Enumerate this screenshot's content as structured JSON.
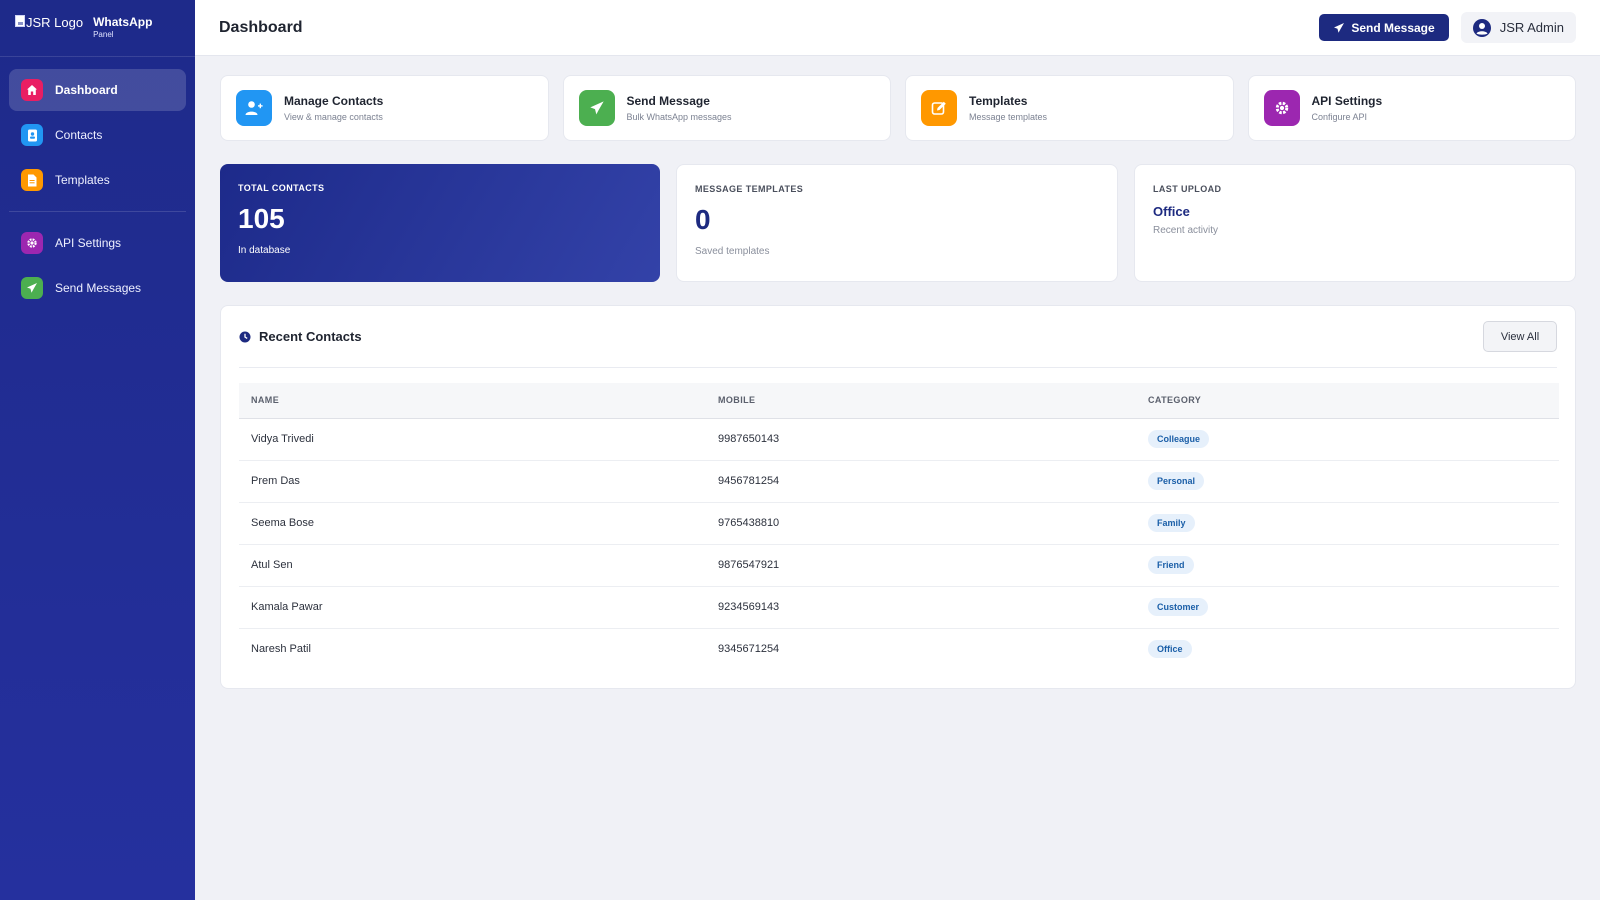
{
  "sidebar": {
    "logo_alt": "JSR Logo",
    "brand_title": "WhatsApp",
    "brand_subtitle": "Panel",
    "items": [
      {
        "label": "Dashboard",
        "icon": "home-icon",
        "color": "#e91e63"
      },
      {
        "label": "Contacts",
        "icon": "contacts-icon",
        "color": "#2196f3"
      },
      {
        "label": "Templates",
        "icon": "document-icon",
        "color": "#ff9800"
      },
      {
        "label": "API Settings",
        "icon": "gear-icon",
        "color": "#9c27b0"
      },
      {
        "label": "Send Messages",
        "icon": "paper-plane-icon",
        "color": "#4caf50"
      }
    ]
  },
  "header": {
    "title": "Dashboard",
    "send_button": "Send Message",
    "user_name": "JSR Admin"
  },
  "quick_actions": [
    {
      "title": "Manage Contacts",
      "subtitle": "View & manage contacts",
      "icon": "add-user-icon",
      "color": "#2196f3"
    },
    {
      "title": "Send Message",
      "subtitle": "Bulk WhatsApp messages",
      "icon": "paper-plane-icon",
      "color": "#4caf50"
    },
    {
      "title": "Templates",
      "subtitle": "Message templates",
      "icon": "edit-icon",
      "color": "#ff9800"
    },
    {
      "title": "API Settings",
      "subtitle": "Configure API",
      "icon": "gear-icon",
      "color": "#9c27b0"
    }
  ],
  "stats": {
    "total_contacts": {
      "label": "TOTAL CONTACTS",
      "value": "105",
      "sub": "In database"
    },
    "message_templates": {
      "label": "MESSAGE TEMPLATES",
      "value": "0",
      "sub": "Saved templates"
    },
    "last_upload": {
      "label": "LAST UPLOAD",
      "value": "Office",
      "sub": "Recent activity"
    }
  },
  "recent": {
    "title": "Recent Contacts",
    "view_all": "View All",
    "columns": [
      "NAME",
      "MOBILE",
      "CATEGORY"
    ],
    "rows": [
      {
        "name": "Vidya Trivedi",
        "mobile": "9987650143",
        "category": "Colleague"
      },
      {
        "name": "Prem Das",
        "mobile": "9456781254",
        "category": "Personal"
      },
      {
        "name": "Seema Bose",
        "mobile": "9765438810",
        "category": "Family"
      },
      {
        "name": "Atul Sen",
        "mobile": "9876547921",
        "category": "Friend"
      },
      {
        "name": "Kamala Pawar",
        "mobile": "9234569143",
        "category": "Customer"
      },
      {
        "name": "Naresh Patil",
        "mobile": "9345671254",
        "category": "Office"
      }
    ]
  }
}
